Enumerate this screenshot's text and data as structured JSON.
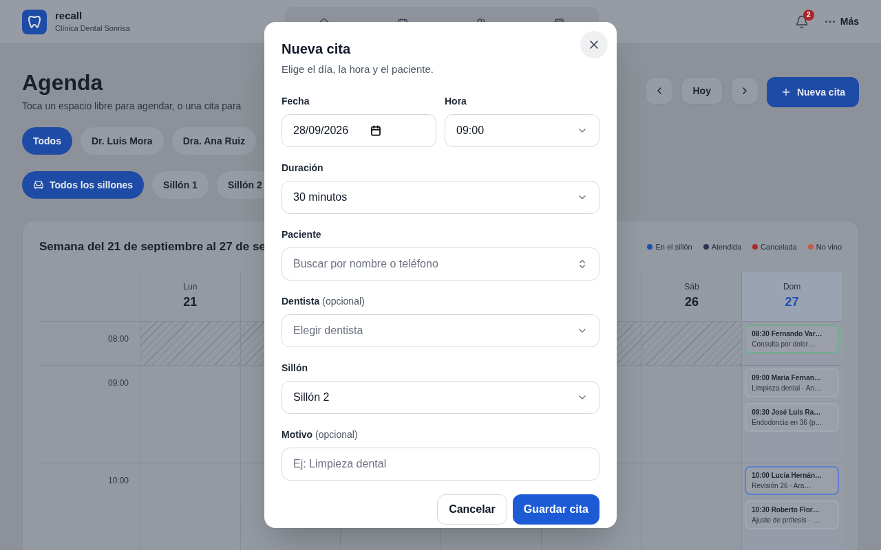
{
  "header": {
    "brand": "recall",
    "clinic": "Clínica Dental Sonrisa",
    "notifications": "2",
    "more": "Más"
  },
  "page": {
    "title": "Agenda",
    "subtitle": "Toca un espacio libre para agendar, o una cita para",
    "today_button": "Hoy",
    "new_button": "Nueva cita"
  },
  "dentist_filters": [
    {
      "label": "Todos",
      "selected": true
    },
    {
      "label": "Dr. Luis Mora",
      "selected": false
    },
    {
      "label": "Dra. Ana Ruiz",
      "selected": false
    }
  ],
  "chair_filters": [
    {
      "label": "Todos los sillones",
      "selected": true
    },
    {
      "label": "Sillón 1",
      "selected": false
    },
    {
      "label": "Sillón 2",
      "selected": false
    }
  ],
  "calendar": {
    "title": "Semana del 21 de septiembre al 27 de se",
    "legend": [
      {
        "label": "En el sillón",
        "color": "#1e50b4"
      },
      {
        "label": "Atendida",
        "color": "#2a3350"
      },
      {
        "label": "Cancelada",
        "color": "#b02a2a"
      },
      {
        "label": "No vino",
        "color": "#c25a4e"
      }
    ],
    "days": [
      {
        "weekday": "Lun",
        "date": "21",
        "today": false
      },
      {
        "weekday": "Sáb",
        "date": "26",
        "today": false
      },
      {
        "weekday": "Dom",
        "date": "27",
        "today": true
      }
    ],
    "slots": [
      {
        "time": "08:00",
        "closed": true,
        "appointments": [
          {
            "title": "08:30 Fernando Var…",
            "detail": "Consulta por dolor…",
            "color": "#6fae8c"
          }
        ]
      },
      {
        "time": "09:00",
        "closed": false,
        "appointments": [
          {
            "title": "09:00 María Fernan…",
            "detail": "Limpieza dental · An…",
            "color": "#a4a9b1"
          },
          {
            "title": "09:30 José Luis Ra…",
            "detail": "Endodoncia en 36 (p…",
            "color": "#a4a9b1"
          }
        ]
      },
      {
        "time": "10:00",
        "closed": false,
        "appointments": [
          {
            "title": "10:00 Lucía Hernán…",
            "detail": "Revisión 26 · Ara…",
            "color": "#5a80c8"
          },
          {
            "title": "10:30 Roberto Flor…",
            "detail": "Ajuste de prótesis · …",
            "color": "#a4a9b1"
          }
        ]
      }
    ]
  },
  "dialog": {
    "title": "Nueva cita",
    "subtitle": "Elige el día, la hora y el paciente.",
    "rows": [
      [
        {
          "kind": "date",
          "label": "Fecha",
          "value": "28/09/2026"
        },
        {
          "kind": "select",
          "label": "Hora",
          "value": "09:00"
        }
      ],
      [
        {
          "kind": "select",
          "label": "Duración",
          "value": "30 minutos"
        }
      ],
      [
        {
          "kind": "combobox",
          "label": "Paciente",
          "placeholder": "Buscar por nombre o teléfono"
        }
      ],
      [
        {
          "kind": "select",
          "label": "Dentista",
          "note": "(opcional)",
          "placeholder": "Elegir dentista"
        }
      ],
      [
        {
          "kind": "select",
          "label": "Sillón",
          "value": "Sillón 2"
        }
      ],
      [
        {
          "kind": "text",
          "label": "Motivo",
          "note": "(opcional)",
          "placeholder": "Ej: Limpieza dental"
        }
      ]
    ],
    "cancel": "Cancelar",
    "save": "Guardar cita"
  }
}
